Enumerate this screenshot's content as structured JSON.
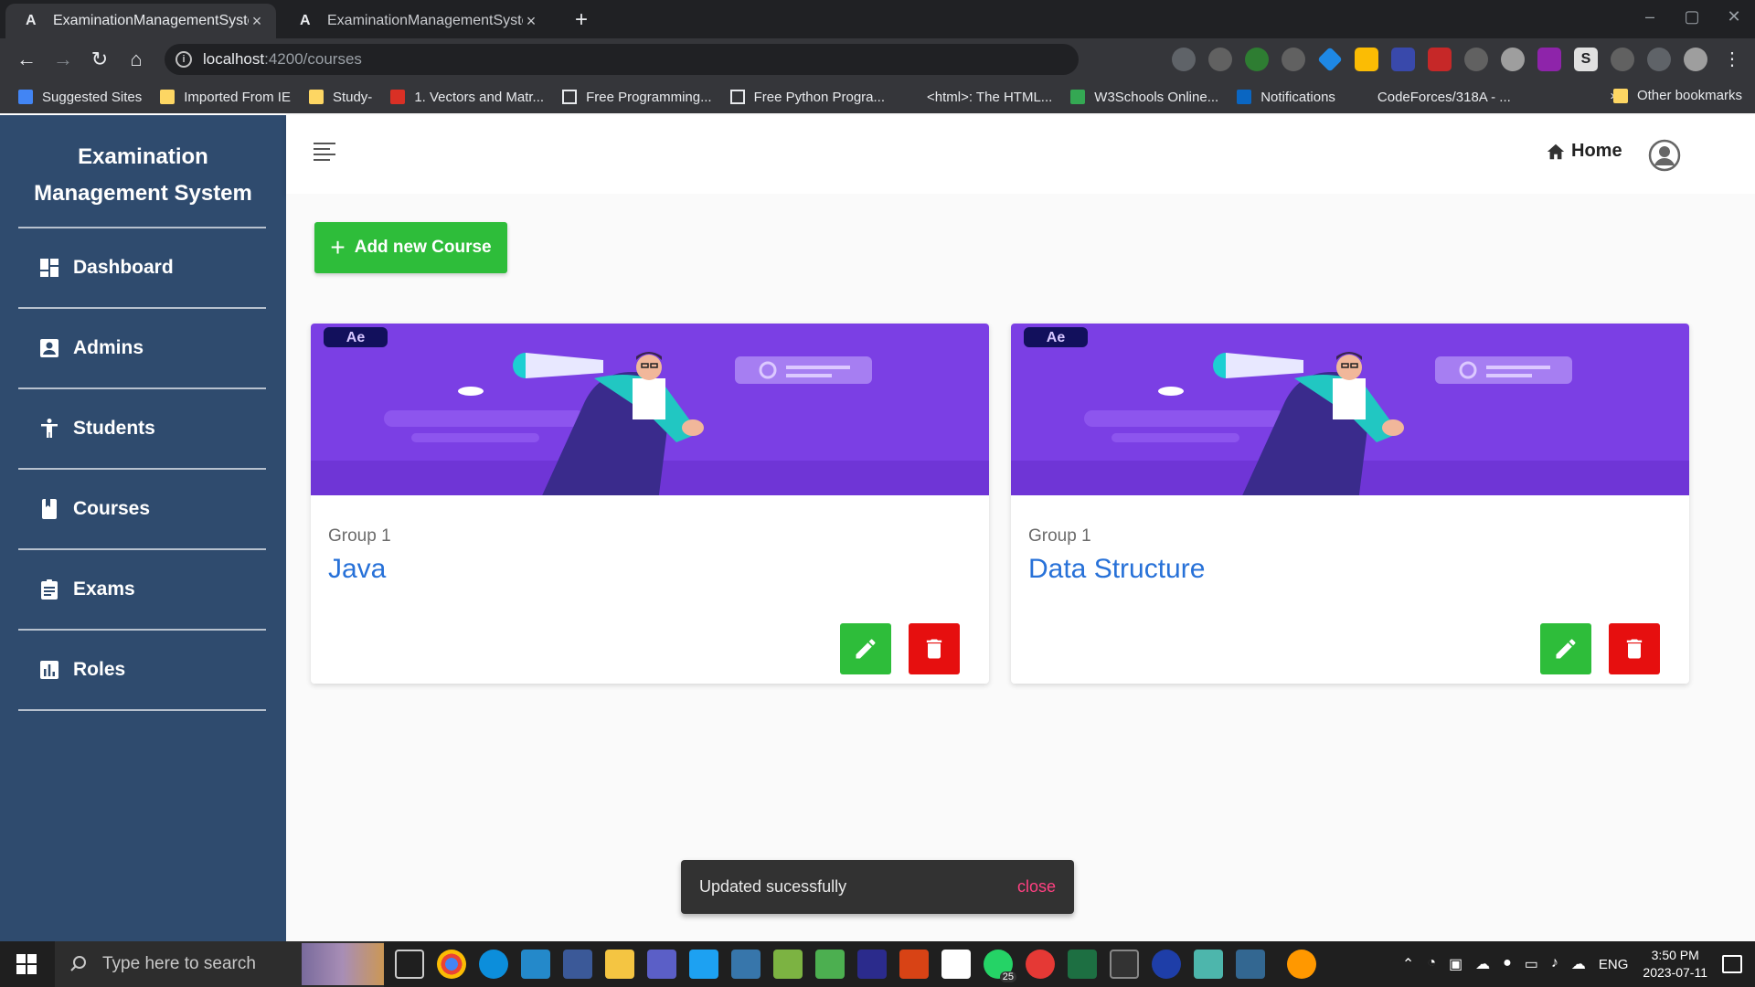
{
  "browser": {
    "tabs": [
      {
        "favicon": "A",
        "title": "ExaminationManagementSystem",
        "active": true
      },
      {
        "favicon": "A",
        "title": "ExaminationManagementSystem",
        "active": false
      }
    ],
    "url_host": "localhost",
    "url_rest": ":4200/courses",
    "bookmarks": [
      "Suggested Sites",
      "Imported From IE",
      "Study-",
      "1. Vectors and Matr...",
      "Free Programming...",
      "Free Python Progra...",
      "<html>: The HTML...",
      "W3Schools Online...",
      "Notifications",
      "CodeForces/318A - ..."
    ],
    "bookmarks_more": "»",
    "other_bookmarks": "Other bookmarks"
  },
  "app": {
    "brand_line1": "Examination",
    "brand_line2": "Management System",
    "nav": [
      {
        "label": "Dashboard",
        "icon": "dashboard-icon"
      },
      {
        "label": "Admins",
        "icon": "person-card-icon"
      },
      {
        "label": "Students",
        "icon": "accessibility-icon"
      },
      {
        "label": "Courses",
        "icon": "book-icon"
      },
      {
        "label": "Exams",
        "icon": "assignment-icon"
      },
      {
        "label": "Roles",
        "icon": "bar-chart-icon"
      }
    ],
    "header": {
      "home_label": "Home"
    },
    "add_button_label": "Add new Course",
    "courses": [
      {
        "group": "Group 1",
        "title": "Java",
        "badge": "Ae"
      },
      {
        "group": "Group 1",
        "title": "Data Structure",
        "badge": "Ae"
      }
    ],
    "snackbar": {
      "message": "Updated sucessfully",
      "action": "close"
    }
  },
  "taskbar": {
    "search_placeholder": "Type here to search",
    "language": "ENG",
    "time": "3:50 PM",
    "date": "2023-07-11",
    "whatsapp_badge": "25"
  },
  "colors": {
    "sidebar": "#2f4b6e",
    "primary_green": "#2ebd3a",
    "danger_red": "#e60f0f",
    "title_blue": "#2771d8",
    "banner_purple": "#7b3fe4"
  }
}
